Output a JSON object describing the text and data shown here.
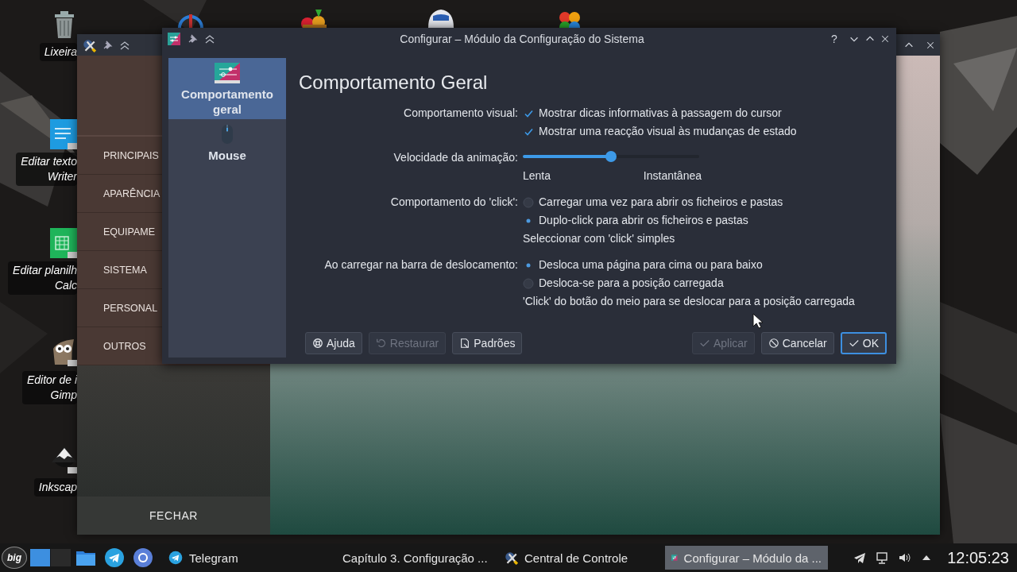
{
  "desktop": {
    "icons": [
      {
        "kind": "trash",
        "lines": [
          "Lixeira"
        ]
      },
      {
        "kind": "writer",
        "lines": [
          "Editar texto",
          "Writer"
        ]
      },
      {
        "kind": "calc",
        "lines": [
          "Editar planilh",
          "Calc"
        ]
      },
      {
        "kind": "gimp",
        "lines": [
          "Editor de i",
          "Gimp"
        ]
      },
      {
        "kind": "inkscape",
        "lines": [
          "Inkscap"
        ]
      }
    ]
  },
  "back_window": {
    "menu": [
      "PRINCIPAIS",
      "APARÊNCIA",
      "EQUIPAME",
      "SISTEMA",
      "PERSONAL",
      "OUTROS"
    ],
    "close_label": "FECHAR"
  },
  "dialog": {
    "title": "Configurar – Módulo da Configuração do Sistema",
    "help": "?",
    "sidebar": [
      {
        "kind": "general",
        "label": "Comportamento geral",
        "selected": true
      },
      {
        "kind": "mouse",
        "label": "Mouse",
        "selected": false
      }
    ],
    "heading": "Comportamento Geral",
    "form": [
      {
        "kind": "checks",
        "label": "Comportamento visual:",
        "options": [
          {
            "label": "Mostrar dicas informativas à passagem do cursor",
            "checked": true
          },
          {
            "label": "Mostrar uma reacção visual às mudanças de estado",
            "checked": true
          }
        ]
      },
      {
        "kind": "slider",
        "label": "Velocidade da animação:",
        "level": 0.5,
        "min_label": "Lenta",
        "max_label": "Instantânea"
      },
      {
        "kind": "radios",
        "label": "Comportamento do 'click':",
        "options": [
          {
            "label": "Carregar uma vez para abrir os ficheiros e pastas",
            "selected": false
          },
          {
            "label": "Duplo-click para abrir os ficheiros e pastas",
            "selected": true
          }
        ],
        "note": "Seleccionar com 'click' simples"
      },
      {
        "kind": "radios",
        "label": "Ao carregar na barra de deslocamento:",
        "options": [
          {
            "label": "Desloca uma página para cima ou para baixo",
            "selected": true
          },
          {
            "label": "Desloca-se para a posição carregada",
            "selected": false
          }
        ],
        "note": "'Click' do botão do meio para se deslocar para a posição carregada"
      }
    ],
    "buttons_left": [
      {
        "kind": "help",
        "label": "Ajuda",
        "disabled": false
      },
      {
        "kind": "reset",
        "label": "Restaurar",
        "disabled": true
      },
      {
        "kind": "defaults",
        "label": "Padrões",
        "disabled": false
      }
    ],
    "buttons_right": [
      {
        "kind": "apply",
        "label": "Aplicar",
        "disabled": true,
        "default": false
      },
      {
        "kind": "cancel",
        "label": "Cancelar",
        "disabled": false,
        "default": false
      },
      {
        "kind": "ok",
        "label": "OK",
        "disabled": false,
        "default": true
      }
    ]
  },
  "taskbar": {
    "launcher": "big",
    "pager": [
      {
        "selected": true
      },
      {
        "selected": false
      }
    ],
    "tasks": [
      {
        "kind": "telegram",
        "label": "Telegram",
        "selected": false
      },
      {
        "kind": "browser",
        "label": "Capítulo 3. Configuração ...",
        "selected": false
      },
      {
        "kind": "control",
        "label": "Central de Controle",
        "selected": false
      },
      {
        "kind": "settings",
        "label": "Configurar – Módulo da ...",
        "selected": true
      }
    ],
    "clock": "12:05:23"
  }
}
